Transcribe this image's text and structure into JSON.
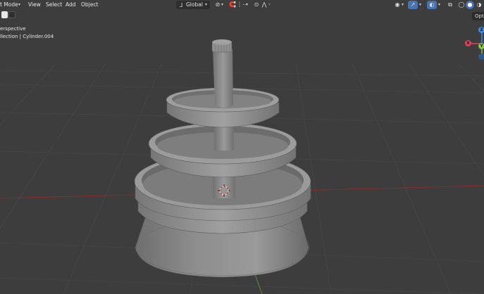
{
  "header": {
    "mode_label": "t Mode",
    "menus": [
      "View",
      "Select",
      "Add",
      "Object"
    ],
    "transform_orientation": "Global"
  },
  "overlay": {
    "view_name": "erspective",
    "collection_info": "llection | Cylinder.004"
  },
  "sidebar": {
    "options_label": "Opt"
  },
  "gizmo": {
    "y_label": "Y",
    "z_label": "Z",
    "x_label": "X"
  },
  "colors": {
    "viewport_bg": "#3d3d3d",
    "grid_line": "#454545",
    "x_axis": "#8a2d2d",
    "y_axis": "#5e8a2e",
    "model_gray": "#8c8c8c",
    "x_gizmo": "#e3445f",
    "y_gizmo": "#8bc63e",
    "z_gizmo": "#3d8ee0"
  }
}
